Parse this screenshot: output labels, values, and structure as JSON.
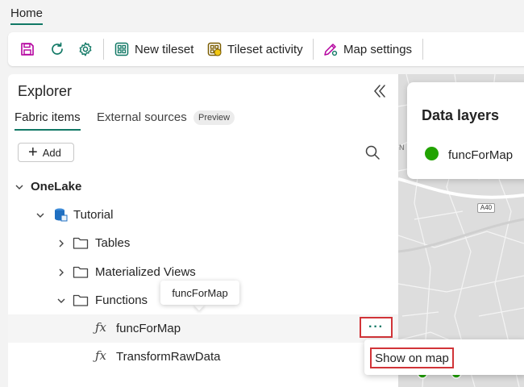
{
  "ribbon": {
    "active_tab": "Home"
  },
  "toolbar": {
    "new_tileset": "New tileset",
    "tileset_activity": "Tileset activity",
    "map_settings": "Map settings"
  },
  "explorer": {
    "title": "Explorer",
    "tabs": [
      "Fabric items",
      "External sources"
    ],
    "preview_badge": "Preview",
    "add_label": "Add",
    "tree": {
      "root": "OneLake",
      "item": "Tutorial",
      "folders": [
        "Tables",
        "Materialized Views",
        "Functions"
      ],
      "functions": [
        "funcForMap",
        "TransformRawData"
      ]
    },
    "tooltip": "funcForMap",
    "more_label": "···"
  },
  "map": {
    "road_label": "A40",
    "edge_label": "N",
    "data_layers_title": "Data layers",
    "layer_name": "funcForMap",
    "layer_color": "#21a300"
  },
  "context_menu": {
    "show_on_map": "Show on map"
  },
  "colors": {
    "accent": "#117865",
    "highlight": "#d13438"
  }
}
